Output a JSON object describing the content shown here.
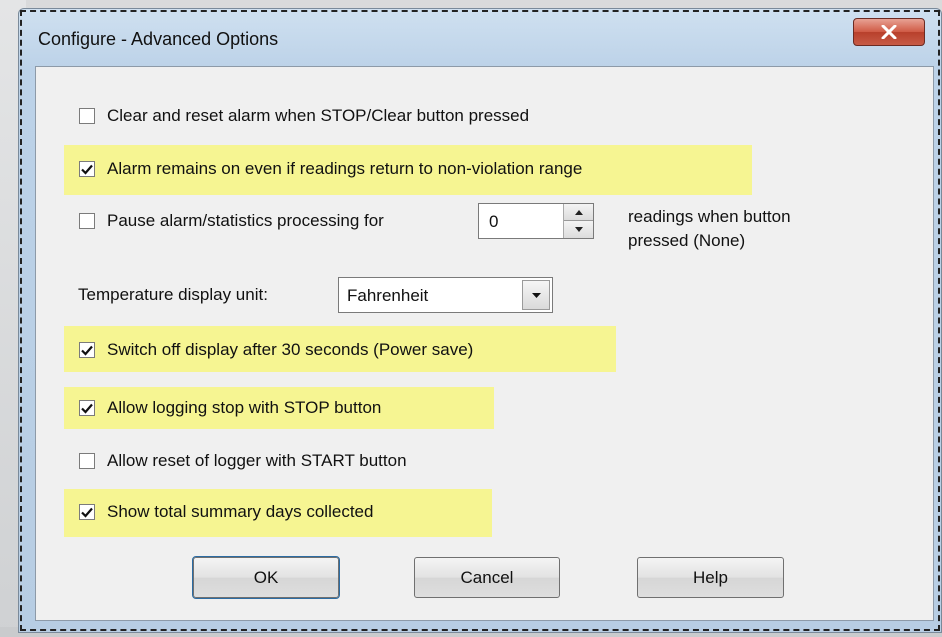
{
  "window": {
    "title": "Configure  - Advanced Options"
  },
  "options": {
    "clear_reset": {
      "label": "Clear and reset alarm when STOP/Clear button pressed",
      "checked": false
    },
    "alarm_remains": {
      "label": "Alarm remains on even if readings return to non-violation range",
      "checked": true
    },
    "pause_alarm": {
      "label": "Pause alarm/statistics processing for",
      "checked": false
    },
    "switch_off": {
      "label": "Switch off display after 30 seconds (Power save)",
      "checked": true
    },
    "allow_stop": {
      "label": "Allow logging stop with STOP button",
      "checked": true
    },
    "allow_reset": {
      "label": "Allow reset of logger with START button",
      "checked": false
    },
    "show_summary": {
      "label": "Show total summary days collected",
      "checked": true
    }
  },
  "pause": {
    "value": "0",
    "suffix_line1": "readings when button",
    "suffix_line2": "pressed (None)"
  },
  "temperature": {
    "label": "Temperature display unit:",
    "selected": "Fahrenheit"
  },
  "buttons": {
    "ok": "OK",
    "cancel": "Cancel",
    "help": "Help"
  },
  "colors": {
    "highlight": "#f6f592",
    "close_button": "#c75b46"
  }
}
